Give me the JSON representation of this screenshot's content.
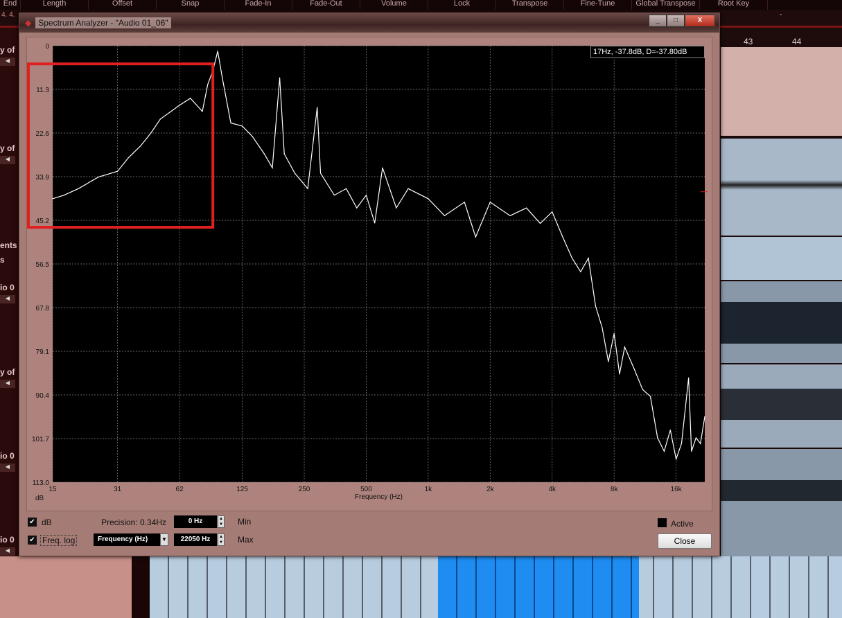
{
  "topbar": [
    "End",
    "Length",
    "Offset",
    "Snap",
    "Fade-In",
    "Fade-Out",
    "Volume",
    "Lock",
    "Transpose",
    "Fine-Tune",
    "Global Transpose",
    "Root Key"
  ],
  "subbar": "4. 4.",
  "root_key_value": "-",
  "ruler": [
    "43",
    "44"
  ],
  "left_tracks": [
    "y of",
    "y of",
    "ents",
    "s",
    "io 0",
    "y of",
    "io 0",
    "io 0"
  ],
  "window": {
    "title": "Spectrum Analyzer - \"Audio 01_06\"",
    "minimize": "_",
    "maximize": "□",
    "close": "X"
  },
  "readout": "17Hz, -37.8dB, D=-37.80dB",
  "controls": {
    "db_label": "dB",
    "db_checked": true,
    "freqlog_label": "Freq. log",
    "freqlog_checked": true,
    "precision": "Precision: 0.34Hz",
    "min_value": "0 Hz",
    "min_label": "Min",
    "max_value": "22050 Hz",
    "max_label": "Max",
    "unit_select": "Frequency (Hz)",
    "active_label": "Active",
    "close_label": "Close"
  },
  "chart_data": {
    "type": "line",
    "xlabel": "Frequency (Hz)",
    "ylabel": "dB",
    "xscale": "log",
    "xlim": [
      15,
      22050
    ],
    "ylim": [
      -113,
      0
    ],
    "grid": true,
    "y_ticks": [
      "0",
      "11.3",
      "22.6",
      "33.9",
      "45.2",
      "56.5",
      "67.8",
      "79.1",
      "90.4",
      "101.7",
      "113.0"
    ],
    "x_ticks": [
      {
        "v": 15,
        "l": "15"
      },
      {
        "v": 31,
        "l": "31"
      },
      {
        "v": 62,
        "l": "62"
      },
      {
        "v": 125,
        "l": "125"
      },
      {
        "v": 250,
        "l": "250"
      },
      {
        "v": 500,
        "l": "500"
      },
      {
        "v": 1000,
        "l": "1k"
      },
      {
        "v": 2000,
        "l": "2k"
      },
      {
        "v": 4000,
        "l": "4k"
      },
      {
        "v": 8000,
        "l": "8k"
      },
      {
        "v": 16000,
        "l": "16k"
      }
    ],
    "series": [
      {
        "name": "spectrum",
        "color": "#ffffff",
        "points": [
          [
            15,
            -39.6
          ],
          [
            17,
            -38.7
          ],
          [
            20,
            -37
          ],
          [
            25,
            -34
          ],
          [
            31,
            -32.5
          ],
          [
            35,
            -29
          ],
          [
            40,
            -26
          ],
          [
            45,
            -22.6
          ],
          [
            50,
            -19
          ],
          [
            62,
            -15.4
          ],
          [
            70,
            -13.6
          ],
          [
            80,
            -17
          ],
          [
            85,
            -10
          ],
          [
            90,
            -6.5
          ],
          [
            95,
            -1.4
          ],
          [
            100,
            -8.3
          ],
          [
            110,
            -20
          ],
          [
            125,
            -20.8
          ],
          [
            140,
            -23.5
          ],
          [
            160,
            -28
          ],
          [
            175,
            -31.6
          ],
          [
            190,
            -8.3
          ],
          [
            200,
            -28
          ],
          [
            225,
            -33
          ],
          [
            260,
            -37
          ],
          [
            289,
            -16
          ],
          [
            300,
            -33
          ],
          [
            350,
            -38.7
          ],
          [
            400,
            -37
          ],
          [
            450,
            -42
          ],
          [
            500,
            -38.7
          ],
          [
            550,
            -45.9
          ],
          [
            600,
            -31.6
          ],
          [
            700,
            -42
          ],
          [
            800,
            -37
          ],
          [
            1000,
            -39.6
          ],
          [
            1200,
            -44
          ],
          [
            1500,
            -40.5
          ],
          [
            1700,
            -49.5
          ],
          [
            2000,
            -40.5
          ],
          [
            2500,
            -44
          ],
          [
            3000,
            -42
          ],
          [
            3500,
            -46
          ],
          [
            4000,
            -43
          ],
          [
            4500,
            -49.5
          ],
          [
            5000,
            -55
          ],
          [
            5500,
            -58.5
          ],
          [
            6000,
            -55
          ],
          [
            6500,
            -67.4
          ],
          [
            7000,
            -73
          ],
          [
            7500,
            -81.8
          ],
          [
            8000,
            -74.5
          ],
          [
            8500,
            -85
          ],
          [
            9000,
            -78
          ],
          [
            10000,
            -83.6
          ],
          [
            11000,
            -89
          ],
          [
            12000,
            -90.8
          ],
          [
            13000,
            -101.5
          ],
          [
            14000,
            -105
          ],
          [
            15000,
            -99.5
          ],
          [
            16000,
            -107
          ],
          [
            17000,
            -103
          ],
          [
            18400,
            -86
          ],
          [
            19000,
            -105
          ],
          [
            20000,
            -101.5
          ],
          [
            21000,
            -103
          ],
          [
            22050,
            -96
          ]
        ]
      }
    ],
    "annotation": {
      "type": "highlight-box",
      "color": "#e02020",
      "x_range": [
        15,
        90
      ],
      "y_range": [
        -4.7,
        -47
      ]
    }
  }
}
